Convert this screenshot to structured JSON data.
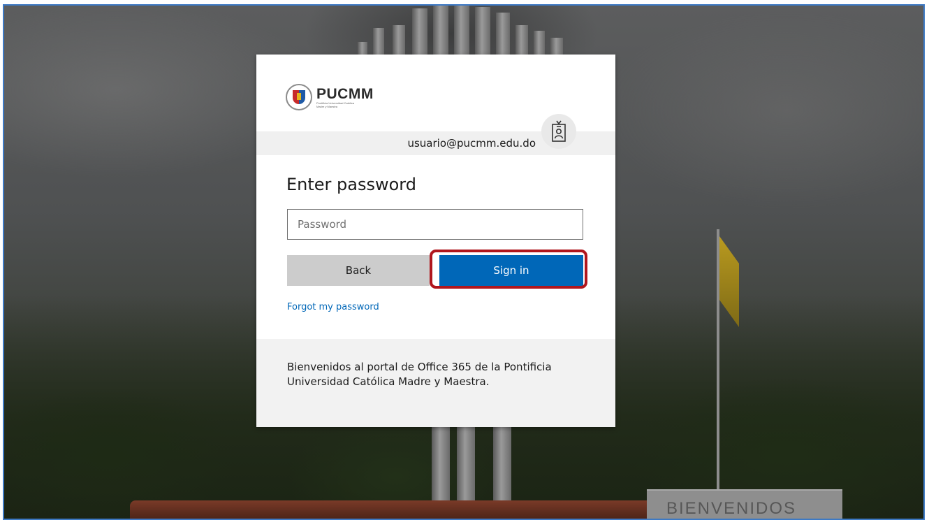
{
  "logo": {
    "name": "PUCMM",
    "subtitle": "Pontificia Universidad Católica Madre y Maestra"
  },
  "identity": {
    "email": "usuario@pucmm.edu.do",
    "badge_icon": "id-badge-icon"
  },
  "form": {
    "heading": "Enter password",
    "password_placeholder": "Password",
    "password_value": "",
    "back_label": "Back",
    "sign_in_label": "Sign in",
    "forgot_label": "Forgot my password"
  },
  "footer": {
    "welcome_text": "Bienvenidos al portal de Office 365 de la Pontificia Universidad Católica Madre y Maestra."
  },
  "background": {
    "sign_text": "BIENVENIDOS"
  },
  "colors": {
    "primary": "#0067b8",
    "highlight": "#b0161d",
    "frame_border": "#3d79c4"
  }
}
